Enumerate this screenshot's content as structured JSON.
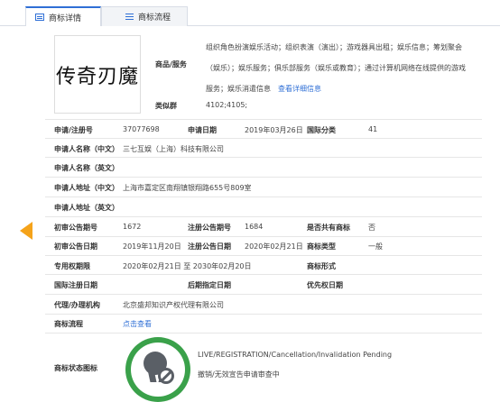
{
  "tabs": [
    {
      "label": "商标详情",
      "icon": "document-icon",
      "active": true
    },
    {
      "label": "商标流程",
      "icon": "list-icon",
      "active": false
    }
  ],
  "trademark": {
    "logo_text": "传奇刃魔",
    "goods_services_label": "商品/服务",
    "goods_services_text": "组织角色扮演娱乐活动；组织表演（演出）；游戏器具出租；娱乐信息；筹划聚会（娱乐）；娱乐服务；俱乐部服务（娱乐或教育）；通过计算机网络在线提供的游戏服务；娱乐消遣信息",
    "view_details_link": "查看详细信息",
    "similar_group_label": "类似群",
    "similar_group_value": "4102;4105;"
  },
  "rows": {
    "reg_no_label": "申请/注册号",
    "reg_no_value": "37077698",
    "app_date_label": "申请日期",
    "app_date_value": "2019年03月26日",
    "intl_class_label": "国际分类",
    "intl_class_value": "41",
    "applicant_cn_label": "申请人名称（中文）",
    "applicant_cn_value": "三七互娱（上海）科技有限公司",
    "applicant_en_label": "申请人名称（英文）",
    "address_cn_label": "申请人地址（中文）",
    "address_cn_value": "上海市嘉定区南翔镇银翔路655号809室",
    "address_en_label": "申请人地址（英文）",
    "prelim_issue_label": "初审公告期号",
    "prelim_issue_value": "1672",
    "reg_issue_label": "注册公告期号",
    "reg_issue_value": "1684",
    "shared_label": "是否共有商标",
    "shared_value": "否",
    "prelim_date_label": "初审公告日期",
    "prelim_date_value": "2019年11月20日",
    "reg_date_label": "注册公告日期",
    "reg_date_value": "2020年02月21日",
    "tm_type_label": "商标类型",
    "tm_type_value": "一般",
    "exclusive_label": "专用权期限",
    "exclusive_value": "2020年02月21日 至 2030年02月20日",
    "tm_form_label": "商标形式",
    "intl_reg_date_label": "国际注册日期",
    "later_date_label": "后期指定日期",
    "priority_label": "优先权日期",
    "agent_label": "代理/办理机构",
    "agent_value": "北京盛邦知识产权代理有限公司",
    "process_label": "商标流程",
    "process_link": "点击查看",
    "status_icon_label": "商标状态图标",
    "status_en": "LIVE/REGISTRATION/Cancellation/Invalidation Pending",
    "status_cn": "撤销/无效宣告申请审查中"
  }
}
